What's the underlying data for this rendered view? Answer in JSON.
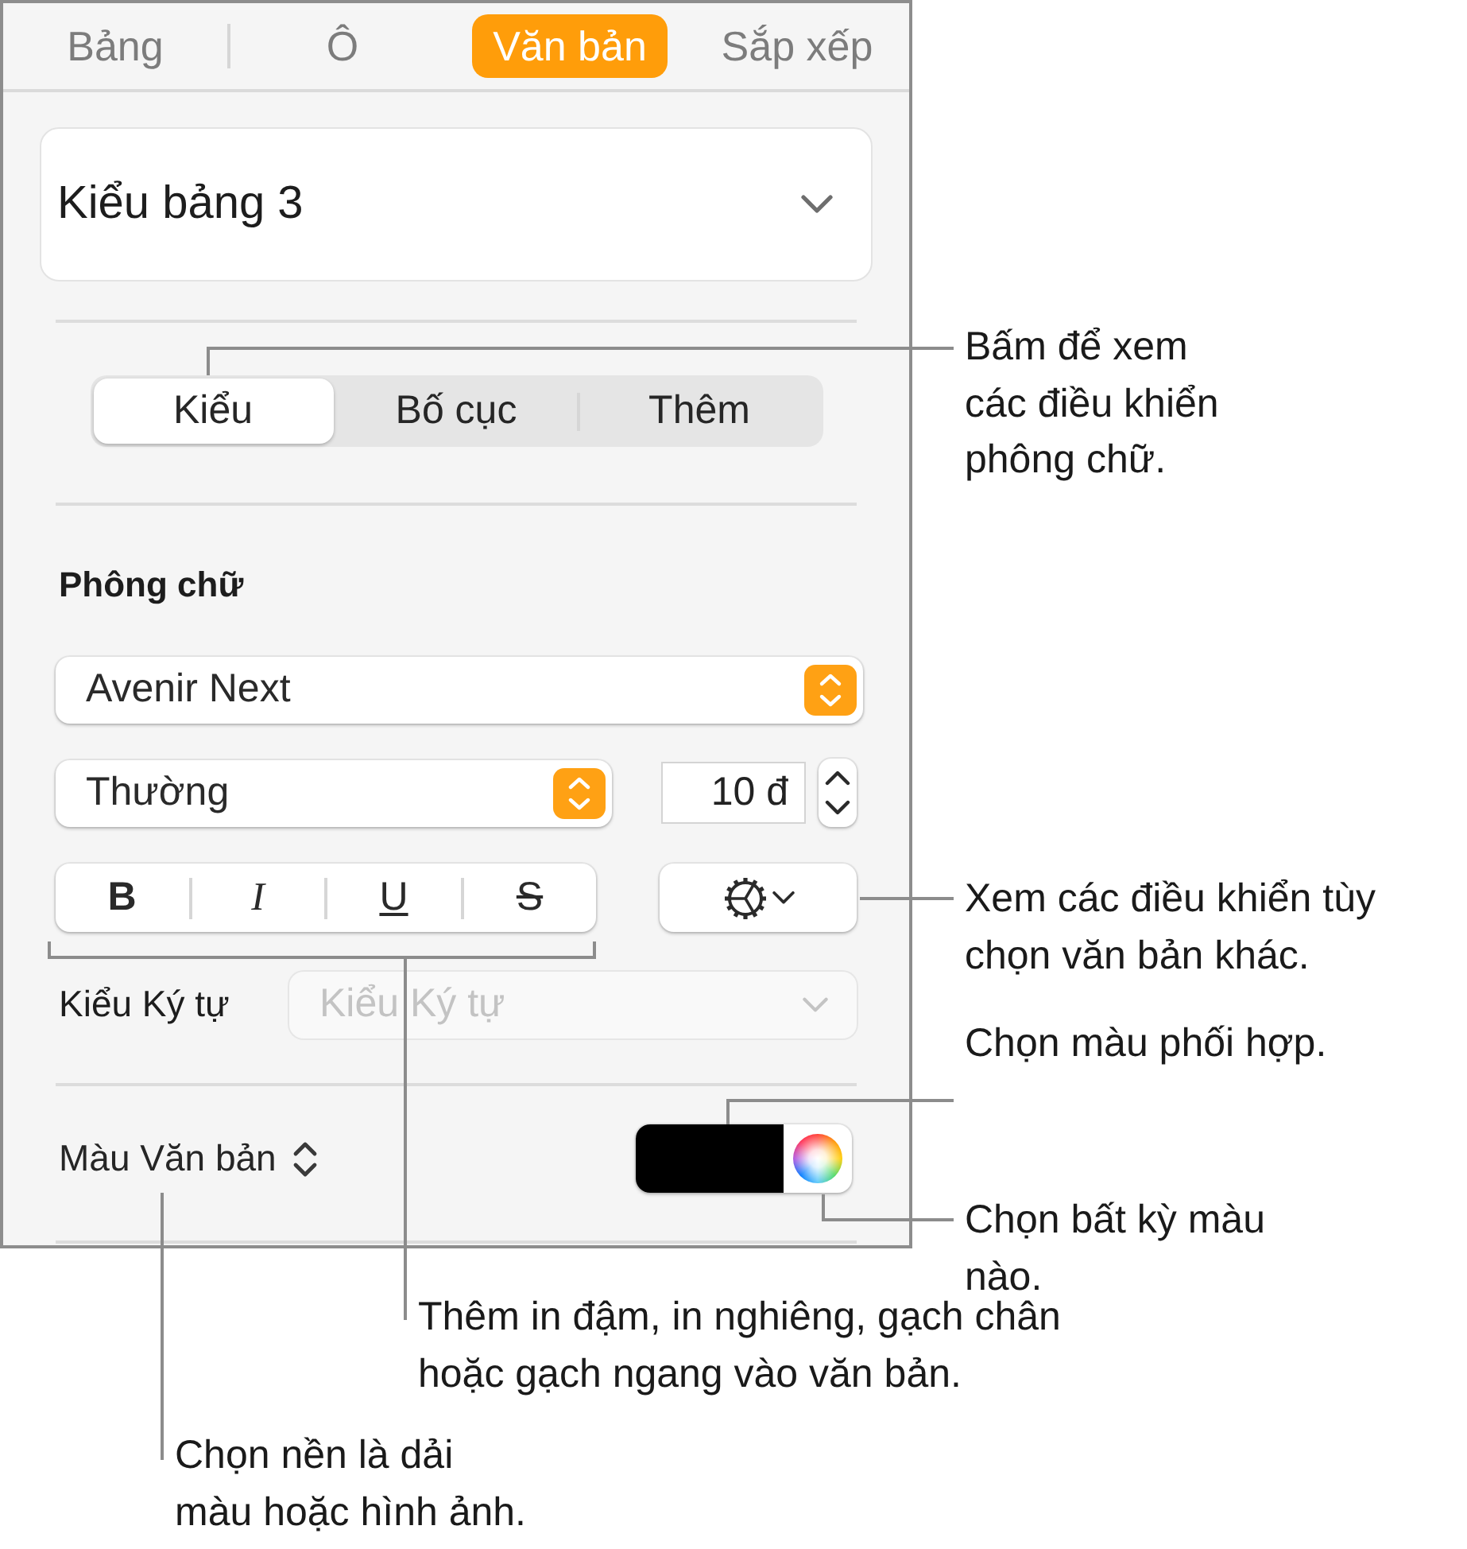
{
  "inspector": {
    "tabs": [
      {
        "label": "Bảng",
        "selected": false
      },
      {
        "label": "Ô",
        "selected": false
      },
      {
        "label": "Văn bản",
        "selected": true
      },
      {
        "label": "Sắp xếp",
        "selected": false
      }
    ],
    "table_style": {
      "value": "Kiểu bảng 3"
    },
    "segments": [
      {
        "label": "Kiểu",
        "selected": true
      },
      {
        "label": "Bố cục",
        "selected": false
      },
      {
        "label": "Thêm",
        "selected": false
      }
    ],
    "font": {
      "title": "Phông chữ",
      "family": "Avenir Next",
      "typeface": "Thường",
      "size": "10 đ",
      "style_buttons": [
        {
          "kind": "bold",
          "label": "B"
        },
        {
          "kind": "italic",
          "label": "I"
        },
        {
          "kind": "underline",
          "label": "U"
        },
        {
          "kind": "strikethrough",
          "label": "S"
        }
      ],
      "character_style": {
        "label": "Kiểu Ký tự",
        "value": "Kiểu Ký tự",
        "disabled": true
      }
    },
    "text_color": {
      "label": "Màu Văn bản",
      "color": "#000000"
    }
  },
  "callouts": [
    {
      "text": "Bấm để xem\ncác điều khiển\nphông chữ."
    },
    {
      "text": "Xem các điều khiển tùy\nchọn văn bản khác."
    },
    {
      "text": "Chọn màu phối hợp."
    },
    {
      "text": "Chọn bất kỳ màu\nnào."
    },
    {
      "text": "Thêm in đậm, in nghiêng, gạch chân\nhoặc gạch ngang vào văn bản."
    },
    {
      "text": "Chọn nền là dải\nmàu hoặc hình ảnh."
    }
  ]
}
